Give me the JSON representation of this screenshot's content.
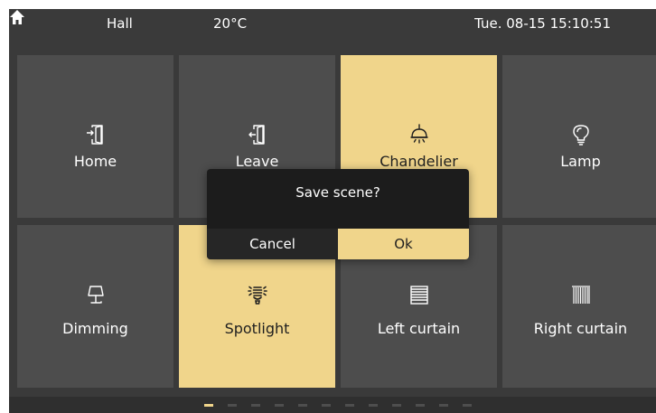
{
  "status": {
    "room": "Hall",
    "temperature": "20°C",
    "datetime": "Tue. 08-15 15:10:51",
    "home_icon": "home-icon"
  },
  "tiles": [
    {
      "label": "Home",
      "icon": "enter-door-icon",
      "active": false
    },
    {
      "label": "Leave",
      "icon": "exit-door-icon",
      "active": false
    },
    {
      "label": "Chandelier",
      "icon": "ceiling-lamp-icon",
      "active": true
    },
    {
      "label": "Lamp",
      "icon": "light-bulb-icon",
      "active": false
    },
    {
      "label": "Dimming",
      "icon": "table-lamp-icon",
      "active": false
    },
    {
      "label": "Spotlight",
      "icon": "energy-bulb-icon",
      "active": true
    },
    {
      "label": "Left curtain",
      "icon": "horizontal-blind-icon",
      "active": false
    },
    {
      "label": "Right curtain",
      "icon": "vertical-blind-icon",
      "active": false
    }
  ],
  "dialog": {
    "title": "Save scene?",
    "cancel_label": "Cancel",
    "ok_label": "Ok"
  },
  "pager": {
    "total_pages": 12,
    "current_page": 1
  },
  "colors": {
    "accent": "#f0d58b",
    "tile": "#4d4d4d",
    "background": "#3a3a3a",
    "dialog": "#1c1c1c"
  }
}
